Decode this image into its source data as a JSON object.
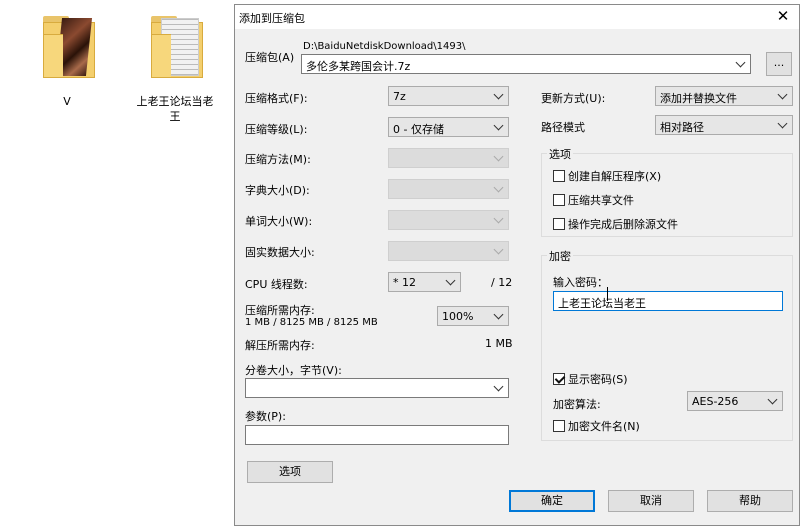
{
  "desktop": {
    "icons": [
      {
        "label": "V"
      },
      {
        "label": "上老王论坛当老王"
      }
    ]
  },
  "dialog": {
    "title": "添加到压缩包",
    "close_glyph": "✕",
    "archive": {
      "label": "压缩包(A)",
      "path": "D:\\BaiduNetdiskDownload\\1493\\",
      "name": "多伦多某跨国会计.7z",
      "browse_label": "..."
    },
    "left": {
      "format_label": "压缩格式(F):",
      "format_value": "7z",
      "level_label": "压缩等级(L):",
      "level_value": "0 - 仅存储",
      "method_label": "压缩方法(M):",
      "dict_label": "字典大小(D):",
      "word_label": "单词大小(W):",
      "solid_label": "固实数据大小:",
      "threads_label": "CPU 线程数:",
      "threads_value": "* 12",
      "threads_max": "/ 12",
      "mem_compress_label": "压缩所需内存:",
      "mem_compress_detail": "1 MB / 8125 MB / 8125 MB",
      "mem_percent": "100%",
      "mem_decompress_label": "解压所需内存:",
      "mem_decompress_value": "1 MB",
      "volume_label": "分卷大小，字节(V):",
      "volume_value": "",
      "params_label": "参数(P):",
      "params_value": "",
      "options_button": "选项"
    },
    "right": {
      "update_label": "更新方式(U):",
      "update_value": "添加并替换文件",
      "pathmode_label": "路径模式",
      "pathmode_value": "相对路径",
      "options_group": "选项",
      "opt_sfx": "创建自解压程序(X)",
      "opt_shared": "压缩共享文件",
      "opt_delete": "操作完成后删除源文件",
      "encryption_group": "加密",
      "password_label": "输入密码：",
      "password_value": "上老王论坛当老王",
      "show_password": "显示密码(S)",
      "method_label": "加密算法:",
      "method_value": "AES-256",
      "encrypt_names": "加密文件名(N)"
    },
    "buttons": {
      "ok": "确定",
      "cancel": "取消",
      "help": "帮助"
    }
  }
}
